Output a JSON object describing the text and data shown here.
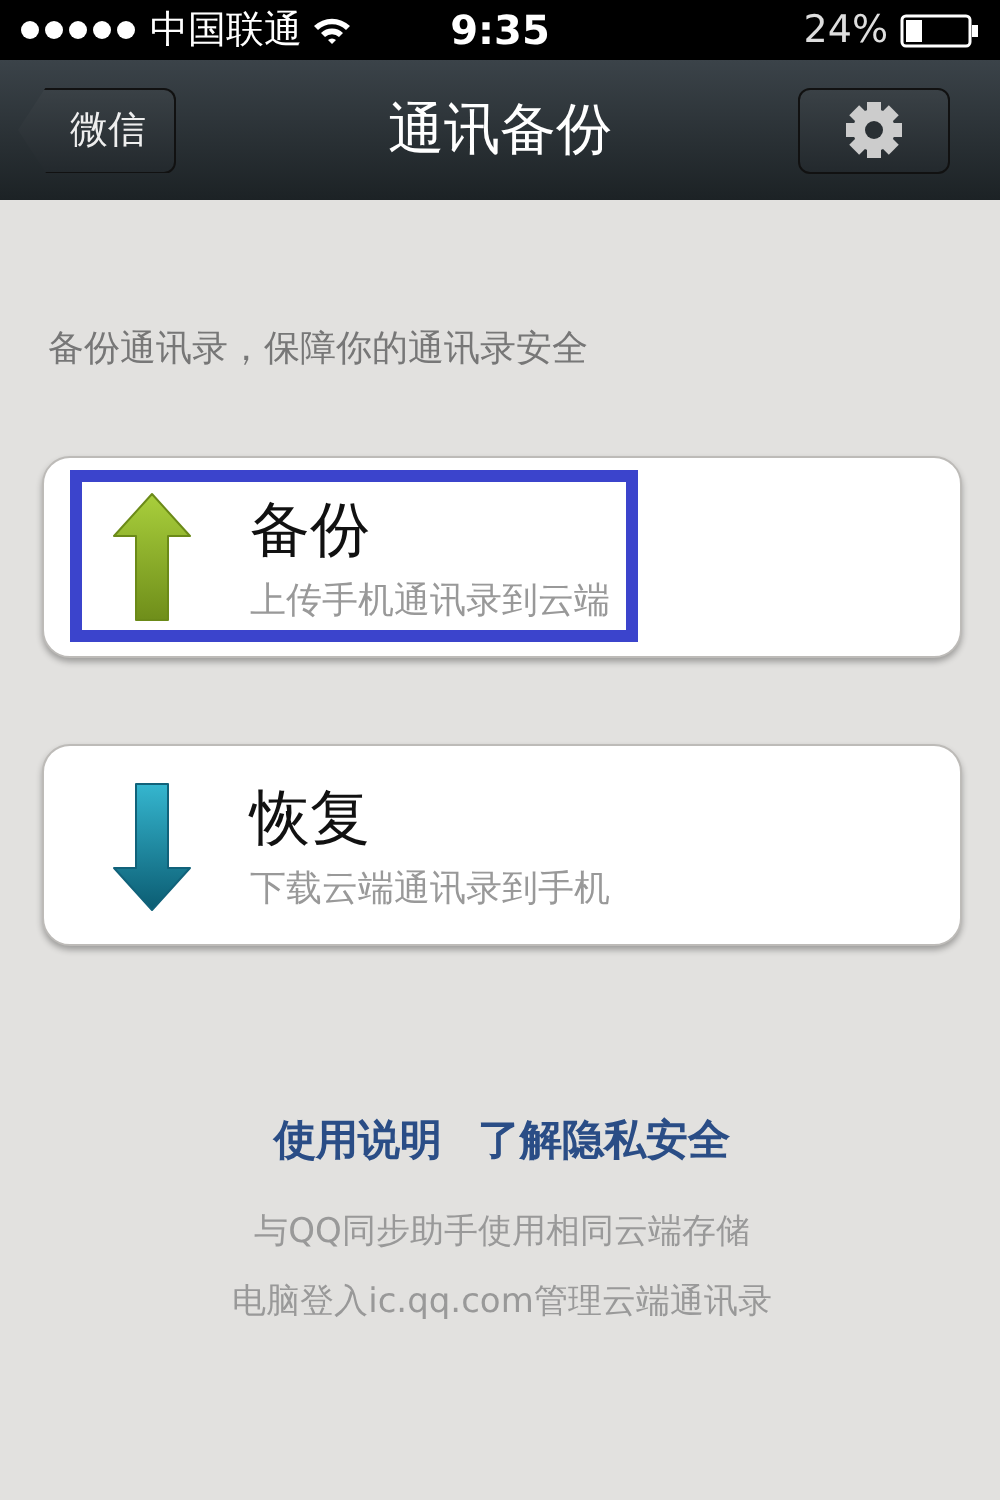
{
  "status_bar": {
    "carrier": "中国联通",
    "time": "9:35",
    "battery": "24%"
  },
  "nav_bar": {
    "back_button": "微信",
    "title": "通讯备份"
  },
  "intro": "备份通讯录，保障你的通讯录安全",
  "actions": [
    {
      "kind": "upload",
      "title": "备份",
      "subtitle": "上传手机通讯录到云端",
      "highlighted": true
    },
    {
      "kind": "download",
      "title": "恢复",
      "subtitle": "下载云端通讯录到手机",
      "highlighted": false
    }
  ],
  "links": [
    "使用说明",
    "了解隐私安全"
  ],
  "notes": [
    "与QQ同步助手使用相同云端存储",
    "电脑登入ic.qq.com管理云端通讯录"
  ]
}
